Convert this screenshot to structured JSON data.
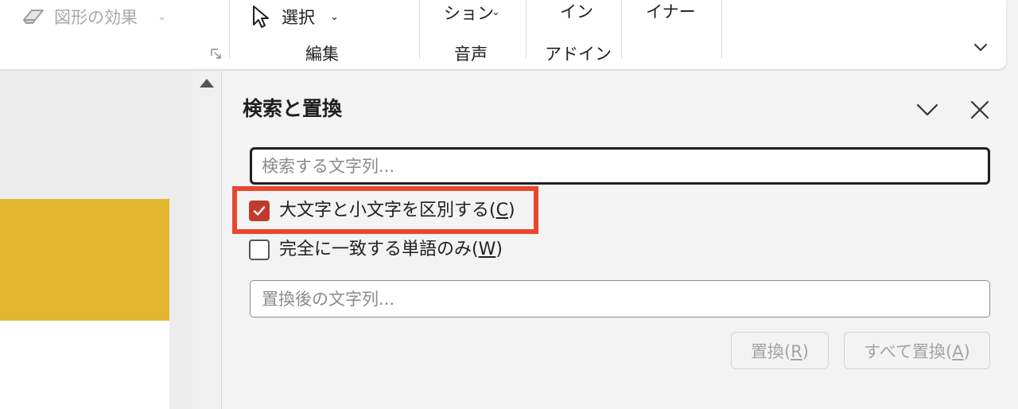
{
  "ribbon": {
    "shape_effects": "図形の効果",
    "select": "選択",
    "edit_group": "編集",
    "motion_partial": "ション",
    "audio_group": "音声",
    "addin_top_partial": "イン",
    "addins_group": "アドイン",
    "designer_partial": "イナー"
  },
  "pane": {
    "title": "検索と置換",
    "find_placeholder": "検索する文字列...",
    "match_case": {
      "label": "大文字と小文字を区別する(",
      "key": "C",
      "close": ")",
      "checked": true
    },
    "whole_word": {
      "label": "完全に一致する単語のみ(",
      "key": "W",
      "close": ")",
      "checked": false
    },
    "replace_placeholder": "置換後の文字列...",
    "replace_button": {
      "label": "置換(",
      "key": "R",
      "close": ")"
    },
    "replace_all_button": {
      "label": "すべて置換(",
      "key": "A",
      "close": ")"
    }
  },
  "colors": {
    "checkbox_checked": "#c23a2b",
    "highlight_box": "#e8472e",
    "slide_yellow": "#e2b62e"
  },
  "icons": {
    "shape_effects": "eraser-icon",
    "select": "pointer-cursor-icon",
    "dialog_launcher": "dialog-launcher-icon",
    "ribbon_collapse": "chevron-down-icon",
    "pane_collapse": "chevron-down-icon",
    "pane_close": "close-icon",
    "scroll_up": "arrow-up-icon",
    "checkbox": "checkmark-icon"
  }
}
